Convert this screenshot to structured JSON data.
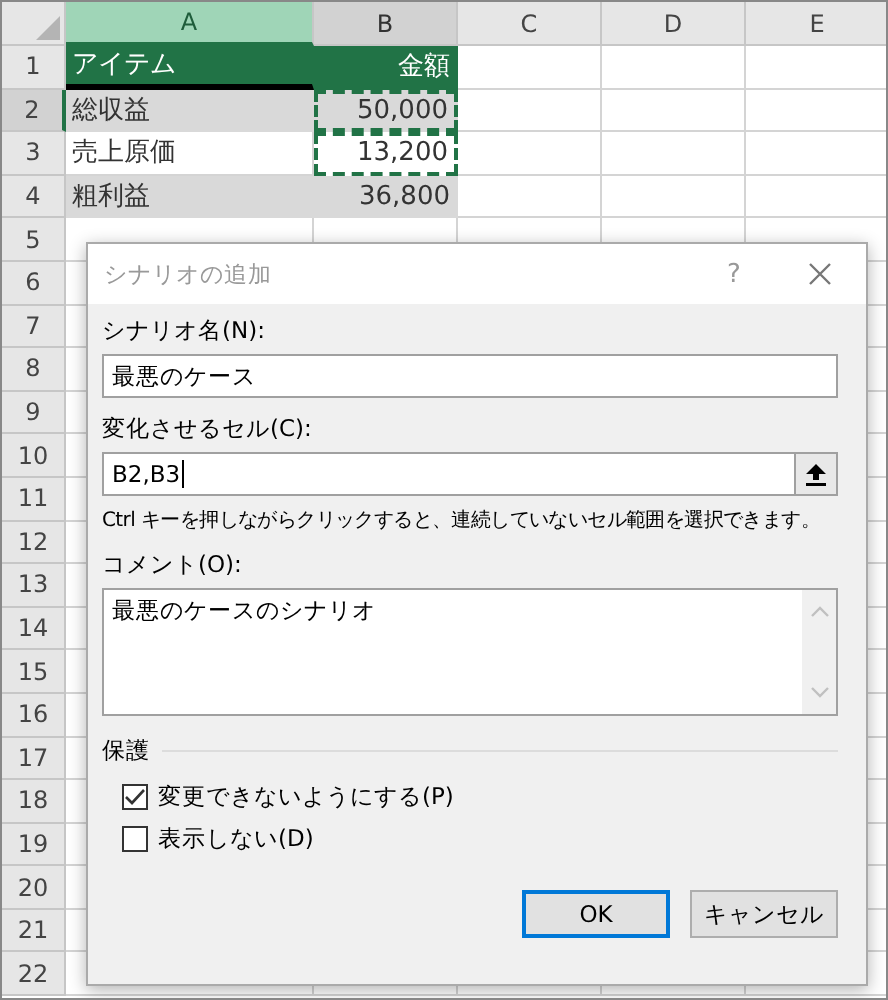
{
  "sheet": {
    "columns": [
      {
        "label": "A",
        "selected": true,
        "highlighted": true
      },
      {
        "label": "B",
        "selected": false,
        "highlighted": true
      },
      {
        "label": "C",
        "selected": false,
        "highlighted": false
      },
      {
        "label": "D",
        "selected": false,
        "highlighted": false
      },
      {
        "label": "E",
        "selected": false,
        "highlighted": false
      }
    ],
    "rows": [
      {
        "number": "1",
        "selected": false,
        "kind": "header",
        "marquee": false,
        "cells": [
          "アイテム",
          "金額"
        ]
      },
      {
        "number": "2",
        "selected": true,
        "kind": "shaded",
        "marquee": true,
        "cells": [
          "総収益",
          "50,000"
        ]
      },
      {
        "number": "3",
        "selected": false,
        "kind": "plain",
        "marquee": true,
        "cells": [
          "売上原価",
          "13,200"
        ]
      },
      {
        "number": "4",
        "selected": false,
        "kind": "shaded",
        "marquee": false,
        "cells": [
          "粗利益",
          "36,800"
        ]
      },
      {
        "number": "5",
        "selected": false
      },
      {
        "number": "6",
        "selected": false
      },
      {
        "number": "7",
        "selected": false
      },
      {
        "number": "8",
        "selected": false
      },
      {
        "number": "9",
        "selected": false
      },
      {
        "number": "10",
        "selected": false
      },
      {
        "number": "11",
        "selected": false
      },
      {
        "number": "12",
        "selected": false
      },
      {
        "number": "13",
        "selected": false
      },
      {
        "number": "14",
        "selected": false
      },
      {
        "number": "15",
        "selected": false
      },
      {
        "number": "16",
        "selected": false
      },
      {
        "number": "17",
        "selected": false
      },
      {
        "number": "18",
        "selected": false
      },
      {
        "number": "19",
        "selected": false
      },
      {
        "number": "20",
        "selected": false
      },
      {
        "number": "21",
        "selected": false
      },
      {
        "number": "22",
        "selected": false
      }
    ]
  },
  "dialog": {
    "title": "シナリオの追加",
    "help": "?",
    "name_label": "シナリオ名(N):",
    "name_value": "最悪のケース",
    "cells_label": "変化させるセル(C):",
    "cells_value": "B2,B3",
    "hint": "Ctrl キーを押しながらクリックすると、連続していないセル範囲を選択できます。",
    "comment_label": "コメント(O):",
    "comment_value": "最悪のケースのシナリオ",
    "protection_label": "保護",
    "checkboxes": [
      {
        "label": "変更できないようにする(P)",
        "checked": true
      },
      {
        "label": "表示しない(D)",
        "checked": false
      }
    ],
    "buttons": [
      {
        "label": "OK",
        "selected": true
      },
      {
        "label": "キャンセル",
        "selected": false
      }
    ]
  }
}
